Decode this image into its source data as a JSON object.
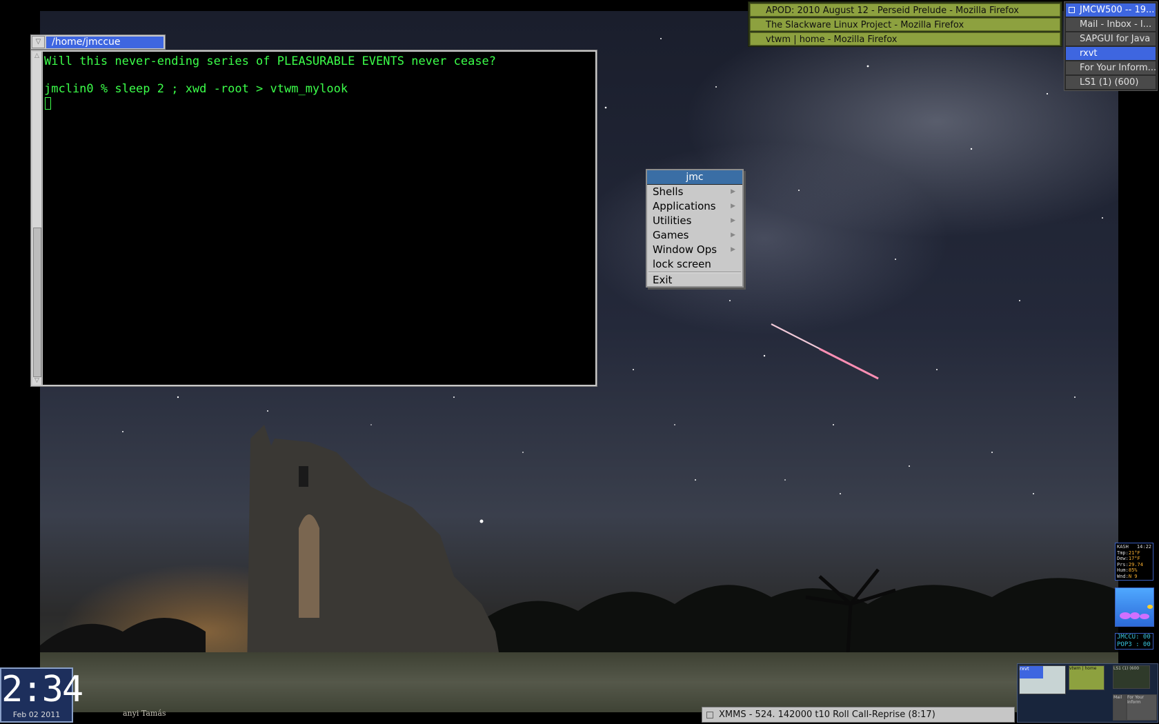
{
  "terminal": {
    "title": "/home/jmccue",
    "lines": [
      "Will this never-ending series of PLEASURABLE EVENTS never cease?",
      "jmclin0 % sleep 2 ; xwd -root > vtwm_mylook"
    ]
  },
  "root_menu": {
    "title": "jmc",
    "items": [
      {
        "label": "Shells",
        "submenu": true
      },
      {
        "label": "Applications",
        "submenu": true
      },
      {
        "label": "Utilities",
        "submenu": true
      },
      {
        "label": "Games",
        "submenu": true
      },
      {
        "label": "Window Ops",
        "submenu": true
      },
      {
        "label": "lock screen",
        "submenu": false
      },
      {
        "label": "Exit",
        "submenu": false
      }
    ]
  },
  "icon_manager": {
    "items": [
      "APOD: 2010 August 12 - Perseid Prelude - Mozilla Firefox",
      "The Slackware Linux Project - Mozilla Firefox",
      "vtwm | home - Mozilla Firefox"
    ]
  },
  "window_list": {
    "items": [
      {
        "label": "JMCW500 -- 19...",
        "active": true
      },
      {
        "label": "Mail - Inbox - I...",
        "active": false
      },
      {
        "label": "SAPGUI for Java",
        "active": false
      },
      {
        "label": "rxvt",
        "active": true
      },
      {
        "label": "For Your Inform...",
        "active": false
      },
      {
        "label": "LS1 (1) (600)",
        "active": false
      }
    ]
  },
  "weather": {
    "station": "KASH",
    "time": "14:22",
    "rows": [
      {
        "k": "Tmp:",
        "v": "21°F"
      },
      {
        "k": "Dew:",
        "v": "17°F"
      },
      {
        "k": "Prs:",
        "v": "29.74"
      },
      {
        "k": "Hum:",
        "v": "85%"
      },
      {
        "k": "Wnd:",
        "v": "N 9"
      }
    ]
  },
  "mail_monitor": {
    "rows": [
      "JMCCU: 00",
      "POP3 : 00"
    ]
  },
  "pager": {
    "labels": [
      "rxvt",
      "vtwm | home",
      "LS1 (1) (600",
      "Mail",
      "For Your Inform"
    ]
  },
  "clock": {
    "time": "2:34",
    "date": "Feb 02 2011"
  },
  "xmms": {
    "label": "XMMS - 524. 142000 t10 Roll Call-Reprise (8:17)"
  },
  "wallpaper": {
    "credit": "anyi Tamás"
  }
}
